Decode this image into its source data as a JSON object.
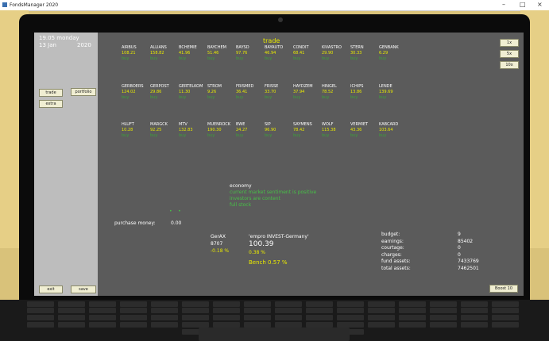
{
  "window": {
    "title": "FondsManager 2020",
    "minimize": "–",
    "maximize": "□",
    "close": "×"
  },
  "sidebar": {
    "date_line1": "19.05 monday",
    "date_line2": "13 Jan",
    "year": "2020",
    "buttons": {
      "trade": "trade",
      "portfolio": "portfolio",
      "extra": "extra",
      "exit": "exit",
      "save": "save"
    }
  },
  "main": {
    "heading": "trade",
    "speed_buttons": [
      "1x",
      "5x",
      "10x"
    ],
    "stocks": [
      {
        "name": "AIRBUS",
        "price": "108.21",
        "action": "buy"
      },
      {
        "name": "ALLIANS",
        "price": "158.82",
        "action": "buy"
      },
      {
        "name": "BCHEMIE",
        "price": "41.96",
        "action": "buy"
      },
      {
        "name": "BAYCHEM",
        "price": "51.46",
        "action": "buy"
      },
      {
        "name": "BAYSD",
        "price": "97.76",
        "action": "buy"
      },
      {
        "name": "BAYAUTO",
        "price": "46.94",
        "action": "buy"
      },
      {
        "name": "CONDIT",
        "price": "68.41",
        "action": "buy"
      },
      {
        "name": "KIVASTRO",
        "price": "29.90",
        "action": "buy"
      },
      {
        "name": "STERN",
        "price": "30.33",
        "action": "buy"
      },
      {
        "name": "GENBANK",
        "price": "6.29",
        "action": "buy"
      },
      {
        "name": "GERBOERS",
        "price": "124.02",
        "action": "buy"
      },
      {
        "name": "GERPOST",
        "price": "29.86",
        "action": "buy"
      },
      {
        "name": "GERTELKOM",
        "price": "11.30",
        "action": "buy"
      },
      {
        "name": "STROM",
        "price": "9.26",
        "action": "buy"
      },
      {
        "name": "FRISMED",
        "price": "36.41",
        "action": "buy"
      },
      {
        "name": "FRISSE",
        "price": "33.70",
        "action": "buy"
      },
      {
        "name": "HAYDZEM",
        "price": "37.94",
        "action": "buy"
      },
      {
        "name": "HINGEL",
        "price": "78.52",
        "action": "buy"
      },
      {
        "name": "ICHIPS",
        "price": "13.86",
        "action": "buy"
      },
      {
        "name": "LENDE",
        "price": "139.69",
        "action": "buy"
      },
      {
        "name": "HLUFT",
        "price": "10.28",
        "action": "buy"
      },
      {
        "name": "MARGCK",
        "price": "92.25",
        "action": "buy"
      },
      {
        "name": "MTV",
        "price": "132.83",
        "action": "buy"
      },
      {
        "name": "MUENROCK",
        "price": "190.30",
        "action": "buy"
      },
      {
        "name": "BWE",
        "price": "24.27",
        "action": "buy"
      },
      {
        "name": "SIP",
        "price": "96.90",
        "action": "buy"
      },
      {
        "name": "SAYMENS",
        "price": "78.42",
        "action": "buy"
      },
      {
        "name": "WOLF",
        "price": "115.38",
        "action": "buy"
      },
      {
        "name": "VERMIET",
        "price": "43.36",
        "action": "buy"
      },
      {
        "name": "KABCARD",
        "price": "103.64",
        "action": "buy"
      }
    ],
    "economy": {
      "title": "economy",
      "lines": [
        "current market sentiment is positive",
        "investors are content",
        "full stock"
      ]
    },
    "purchase_money_label": "purchase money:",
    "purchase_money_value": "0.00",
    "index": {
      "name": "GerAX",
      "value": "8707",
      "change": "-0.18 %"
    },
    "fund": {
      "name": "'empro INVEST-Germany'",
      "value": "100.39",
      "change": "0.38 %",
      "bench": "Bench 0.57 %"
    },
    "finance": [
      {
        "label": "budget:",
        "value": "9"
      },
      {
        "label": "earnings:",
        "value": "85402"
      },
      {
        "label": "courtage:",
        "value": "0"
      },
      {
        "label": "charges:",
        "value": "0"
      },
      {
        "label": "fund assets:",
        "value": "7433769"
      },
      {
        "label": "total assets:",
        "value": "7462501"
      }
    ],
    "boost_button": "Boost 10"
  }
}
